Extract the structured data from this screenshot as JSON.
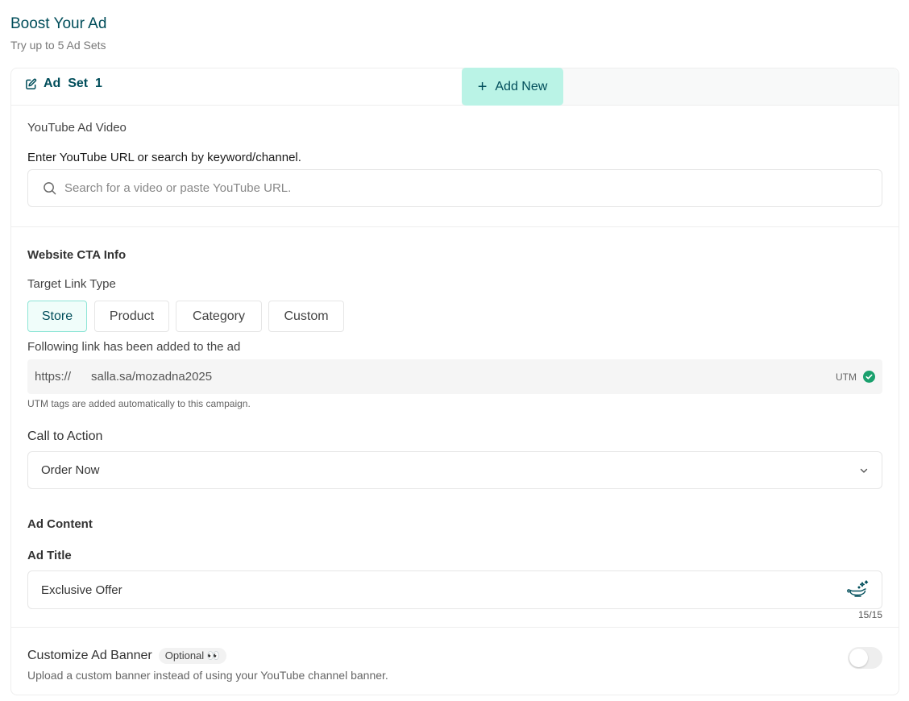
{
  "header": {
    "title": "Boost Your Ad",
    "subtitle": "Try up to 5 Ad Sets"
  },
  "tabs": {
    "active_label": "Ad  Set  1",
    "add_new_label": "Add New"
  },
  "video": {
    "section_label": "YouTube Ad Video",
    "field_label": "Enter YouTube URL or search by keyword/channel.",
    "search_placeholder": "Search for a video or paste YouTube URL."
  },
  "cta": {
    "section_label": "Website CTA Info",
    "link_type_label": "Target Link Type",
    "link_types": [
      {
        "label": "Store",
        "active": true
      },
      {
        "label": "Product",
        "active": false
      },
      {
        "label": "Category",
        "active": false
      },
      {
        "label": "Custom",
        "active": false
      }
    ],
    "link_added_label": "Following link has been added to the ad",
    "link_prefix": "https://",
    "link_url": "salla.sa/mozadna2025",
    "utm_label": "UTM",
    "utm_hint": "UTM tags are added automatically to this campaign.",
    "call_to_action_label": "Call to Action",
    "call_to_action_value": "Order Now"
  },
  "content": {
    "section_label": "Ad Content",
    "title_label": "Ad Title",
    "title_value": "Exclusive Offer",
    "counter": "15/15"
  },
  "banner": {
    "label": "Customize Ad Banner",
    "badge": "Optional 👀",
    "description": "Upload a custom banner instead of using your YouTube channel banner.",
    "enabled": false
  },
  "colors": {
    "brand": "#004d5a",
    "accent": "#baf3e6",
    "success": "#1aa06d"
  }
}
